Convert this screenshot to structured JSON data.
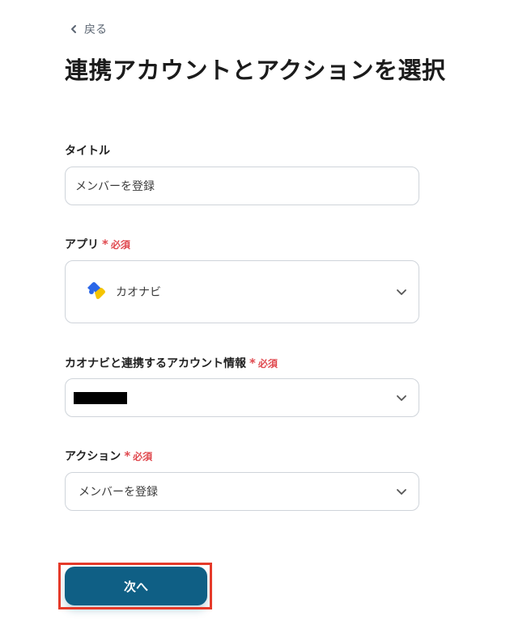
{
  "nav": {
    "back_label": "戻る"
  },
  "page": {
    "title": "連携アカウントとアクションを選択"
  },
  "fields": {
    "title": {
      "label": "タイトル",
      "value": "メンバーを登録"
    },
    "app": {
      "label": "アプリ",
      "required": "必須",
      "required_mark": "*",
      "value": "カオナビ",
      "icon": "kaonavi-logo-icon"
    },
    "account": {
      "label": "カオナビと連携するアカウント情報",
      "required": "必須",
      "required_mark": "*",
      "value_redacted": true
    },
    "action": {
      "label": "アクション",
      "required": "必須",
      "required_mark": "*",
      "value": "メンバーを登録"
    }
  },
  "actions": {
    "next_label": "次へ"
  },
  "colors": {
    "primary": "#0f5f85",
    "required": "#e0494f",
    "highlight": "#e53a2a",
    "logo_blue": "#2b67e8",
    "logo_yellow": "#f5c400"
  }
}
